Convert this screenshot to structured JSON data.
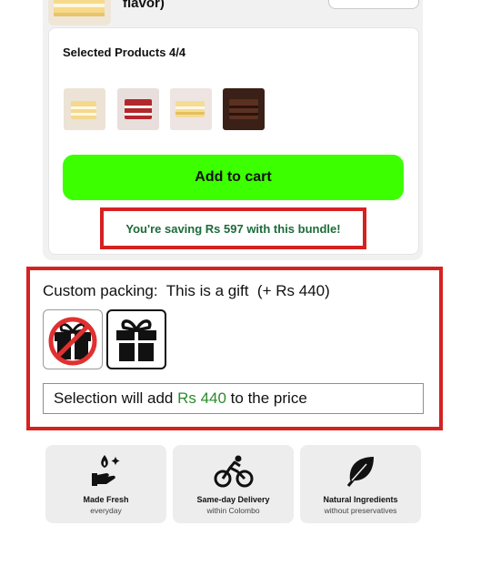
{
  "product": {
    "name_fragment": "flavor)",
    "selected_label": "Selected Products 4/4",
    "thumbnails": [
      "vanilla-cake-slice",
      "red-velvet-cake-slice",
      "vanilla-cake-slice",
      "chocolate-cake-slice"
    ]
  },
  "cart": {
    "add_label": "Add to cart",
    "saving_text": "You're saving Rs 597 with this bundle!"
  },
  "packing": {
    "label": "Custom packing:",
    "selected_value": "This is a gift",
    "price": "(+ Rs 440)",
    "options": [
      "no-gift",
      "gift"
    ],
    "note_prefix": "Selection will add ",
    "note_amount": "Rs 440",
    "note_suffix": " to the price"
  },
  "features": [
    {
      "icon": "fresh-hand-icon",
      "title": "Made Fresh",
      "subtitle": "everyday"
    },
    {
      "icon": "bicycle-icon",
      "title": "Same-day Delivery",
      "subtitle": "within Colombo"
    },
    {
      "icon": "leaf-icon",
      "title": "Natural Ingredients",
      "subtitle": "without preservatives"
    }
  ],
  "colors": {
    "accent_green": "#3cff00",
    "saving_green": "#1d6b3a",
    "highlight_red": "#d62121",
    "price_green": "#2d8a2d"
  }
}
